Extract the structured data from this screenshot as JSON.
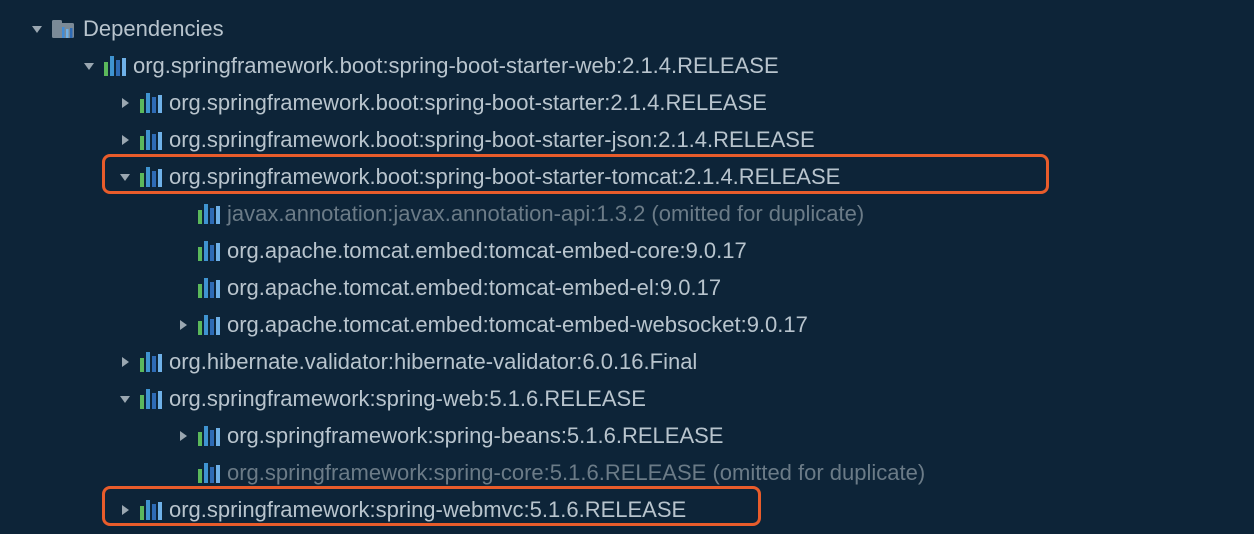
{
  "root": {
    "label": "Dependencies"
  },
  "nodes": {
    "n1": "org.springframework.boot:spring-boot-starter-web:2.1.4.RELEASE",
    "n2": "org.springframework.boot:spring-boot-starter:2.1.4.RELEASE",
    "n3": "org.springframework.boot:spring-boot-starter-json:2.1.4.RELEASE",
    "n4": "org.springframework.boot:spring-boot-starter-tomcat:2.1.4.RELEASE",
    "n5": "javax.annotation:javax.annotation-api:1.3.2",
    "n5_suffix": " (omitted for duplicate)",
    "n6": "org.apache.tomcat.embed:tomcat-embed-core:9.0.17",
    "n7": "org.apache.tomcat.embed:tomcat-embed-el:9.0.17",
    "n8": "org.apache.tomcat.embed:tomcat-embed-websocket:9.0.17",
    "n9": "org.hibernate.validator:hibernate-validator:6.0.16.Final",
    "n10": "org.springframework:spring-web:5.1.6.RELEASE",
    "n11": "org.springframework:spring-beans:5.1.6.RELEASE",
    "n12": "org.springframework:spring-core:5.1.6.RELEASE",
    "n12_suffix": " (omitted for duplicate)",
    "n13": "org.springframework:spring-webmvc:5.1.6.RELEASE"
  }
}
